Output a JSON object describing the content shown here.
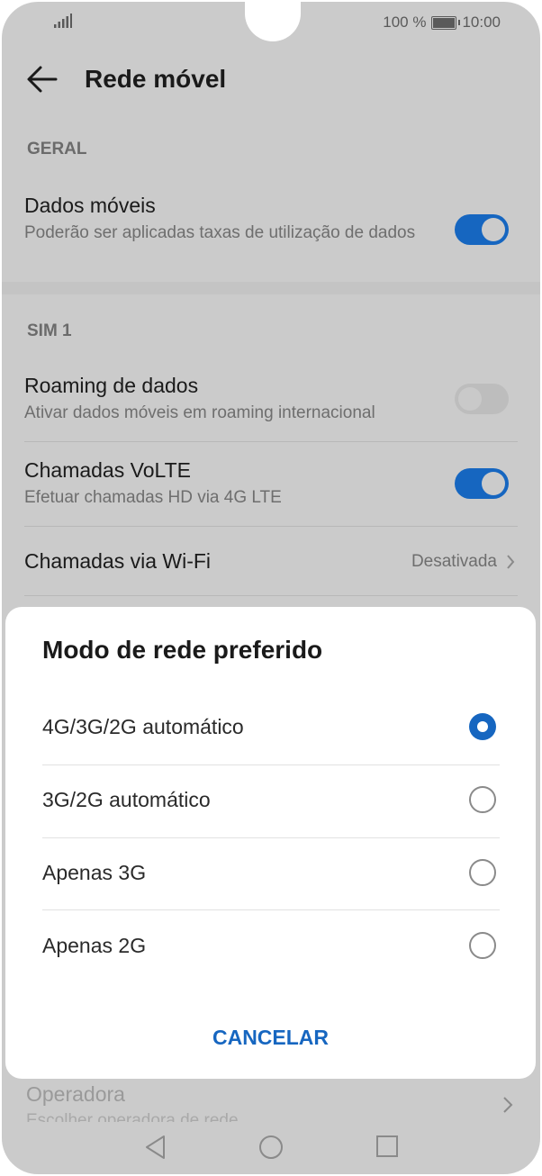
{
  "status_bar": {
    "battery_percent": "100 %",
    "time": "10:00"
  },
  "app_bar": {
    "title": "Rede móvel"
  },
  "sections": {
    "general": "GERAL",
    "sim": "SIM 1"
  },
  "settings": {
    "mobile_data": {
      "title": "Dados móveis",
      "subtitle": "Poderão ser aplicadas taxas de utilização de dados",
      "enabled": true
    },
    "data_roaming": {
      "title": "Roaming de dados",
      "subtitle": "Ativar dados móveis em roaming internacional",
      "enabled": false
    },
    "volte": {
      "title": "Chamadas VoLTE",
      "subtitle": "Efetuar chamadas HD via 4G LTE",
      "enabled": true
    },
    "wifi_calling": {
      "title": "Chamadas via Wi-Fi",
      "value": "Desativada"
    }
  },
  "dialog": {
    "title": "Modo de rede preferido",
    "options": [
      {
        "label": "4G/3G/2G automático",
        "selected": true
      },
      {
        "label": "3G/2G automático",
        "selected": false
      },
      {
        "label": "Apenas 3G",
        "selected": false
      },
      {
        "label": "Apenas 2G",
        "selected": false
      }
    ],
    "cancel_label": "CANCELAR"
  },
  "below_dialog": {
    "operator_title": "Operadora",
    "operator_sub": "Escolher operadora de rede"
  },
  "colors": {
    "accent": "#1666c0",
    "dim_background": "#cbcbcb",
    "dialog_background": "#ffffff"
  }
}
